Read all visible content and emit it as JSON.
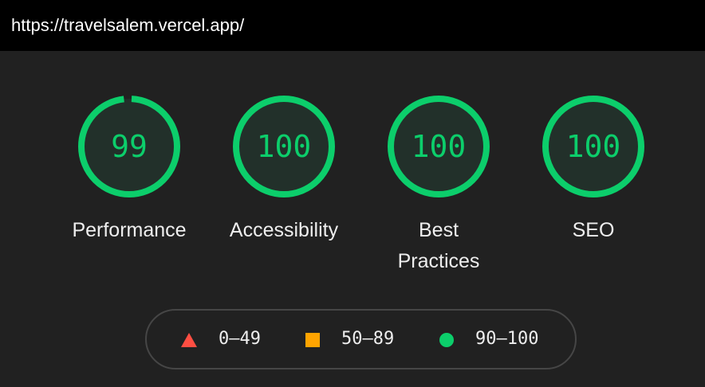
{
  "url_bar": {
    "text": "https://travelsalem.vercel.app/"
  },
  "gauges": [
    {
      "label": "Performance",
      "score": "99",
      "value": 99,
      "color": "#0cce6b"
    },
    {
      "label": "Accessibility",
      "score": "100",
      "value": 100,
      "color": "#0cce6b"
    },
    {
      "label": "Best\nPractices",
      "score": "100",
      "value": 100,
      "color": "#0cce6b"
    },
    {
      "label": "SEO",
      "score": "100",
      "value": 100,
      "color": "#0cce6b"
    }
  ],
  "legend": [
    {
      "range": "0–49",
      "icon": "triangle-icon",
      "color": "#ff4e42"
    },
    {
      "range": "50–89",
      "icon": "square-icon",
      "color": "#ffa400"
    },
    {
      "range": "90–100",
      "icon": "circle-icon",
      "color": "#0cce6b"
    }
  ],
  "colors": {
    "pass": "#0cce6b",
    "gauge_fill": "#1f2f25",
    "background": "#212121"
  }
}
